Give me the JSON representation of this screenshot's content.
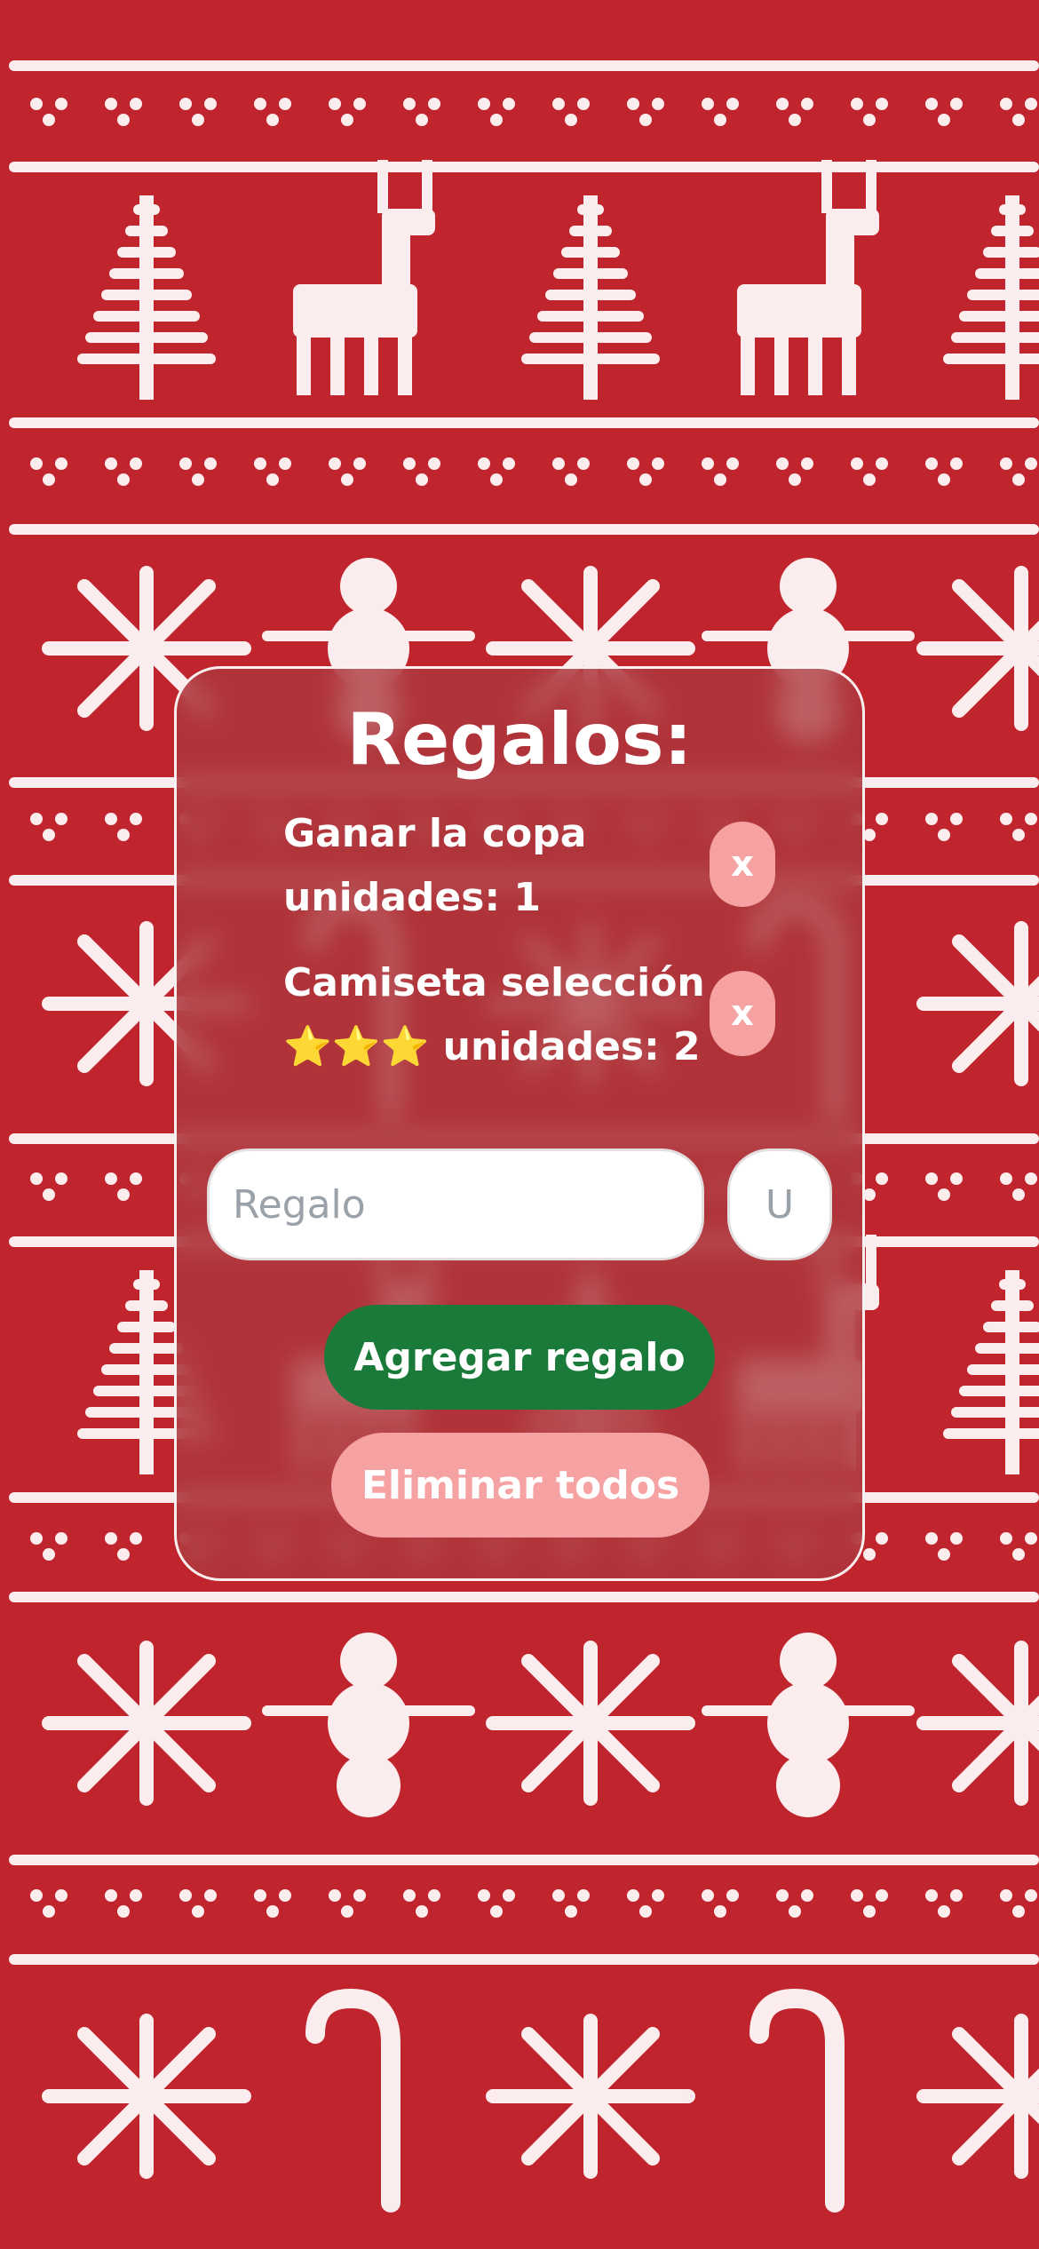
{
  "colors": {
    "background_red": "#c0252d",
    "knit_white": "#fbecee",
    "card_tint": "#aa373c",
    "add_button": "#1a7a39",
    "pink_button": "#f6a1a2"
  },
  "card": {
    "title": "Regalos:",
    "gifts": [
      {
        "line1": "Ganar la copa",
        "line2": "unidades: 1",
        "remove_label": "x"
      },
      {
        "line1": "Camiseta selección",
        "line2": "⭐⭐⭐ unidades: 2",
        "remove_label": "x"
      }
    ],
    "form": {
      "gift_placeholder": "Regalo",
      "gift_value": "",
      "units_placeholder": "U",
      "units_value": "",
      "add_label": "Agregar regalo",
      "clear_label": "Eliminar todos"
    }
  }
}
